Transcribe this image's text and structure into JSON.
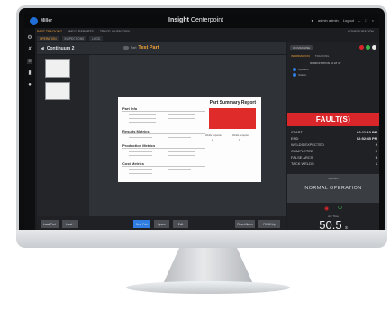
{
  "header": {
    "brand": "Miller",
    "title_bold": "Insight",
    "title_rest": " Centerpoint",
    "user_label": "admin admin",
    "logout_label": "Logout"
  },
  "nav": {
    "tabs": [
      "PART TRACKING",
      "WELD REPORTS",
      "TRACE INVENTORY"
    ],
    "subtabs": [
      "OPERATION",
      "INSPECTIONS",
      "LOGS"
    ],
    "right_link": "CONFIGURATION"
  },
  "workspace": {
    "breadcrumb": "Continuum 2",
    "part_toggle_label": "Part",
    "part_name": "Test Part"
  },
  "document": {
    "title": "Part Summary Report",
    "sections": [
      "Part Info",
      "Results Metrics",
      "Production Metrics",
      "Cost Metrics"
    ],
    "welds_expected_label": "Welds Expected",
    "welds_accepted_label": "Welds Accepted",
    "welds_expected": "2",
    "welds_accepted": "0"
  },
  "buttons": [
    "Load Part",
    "Load +",
    "New Part",
    "Ignore",
    "Edit",
    "Reset Alarm",
    "Fill All Up"
  ],
  "side": {
    "shift_pill": "ON MACHINE",
    "tabs": [
      "INFORMATION",
      "TRACKING"
    ],
    "mini_header": "WORKSTATION 10 AT 47",
    "mini_rows": [
      "Operator",
      "Station"
    ],
    "status": "FAULT(S)",
    "stats": [
      {
        "label": "START",
        "value": "02:11:10 PM"
      },
      {
        "label": "END",
        "value": "02:52:45 PM"
      },
      {
        "label": "WELDS EXPECTED",
        "value": "2"
      },
      {
        "label": "COMPLETED",
        "value": "2"
      },
      {
        "label": "FALSE ARCS",
        "value": "0"
      },
      {
        "label": "TACK WELDS",
        "value": "1"
      }
    ],
    "status_panel_sub": "Operator",
    "status_panel_main": "NORMAL OPERATION",
    "timer_label": "Arc Time",
    "timer_value": "50.5",
    "timer_unit": "s"
  },
  "colors": {
    "accent": "#f2a23a",
    "fault": "#d9262a",
    "primary_button": "#2f7de1"
  }
}
